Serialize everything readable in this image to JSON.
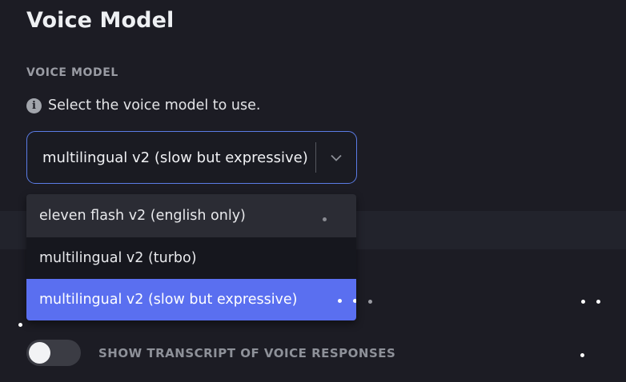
{
  "header": {
    "title": "Voice Model"
  },
  "voice_model": {
    "section_label": "VOICE MODEL",
    "help_icon": "info-icon",
    "help_text": "Select the voice model to use.",
    "selected_value": "multilingual v2 (slow but expressive)",
    "chevron_icon": "chevron-down-icon",
    "options": [
      {
        "label": "eleven flash v2 (english only)",
        "state": "hover"
      },
      {
        "label": "multilingual v2 (turbo)",
        "state": "normal"
      },
      {
        "label": "multilingual v2 (slow but expressive)",
        "state": "selected"
      }
    ]
  },
  "transcript_toggle": {
    "label": "SHOW TRANSCRIPT OF VOICE RESPONSES",
    "enabled": false
  },
  "colors": {
    "background": "#1c1c24",
    "accent_border": "#5b7ce6",
    "selected_option": "#5a6ff0"
  }
}
